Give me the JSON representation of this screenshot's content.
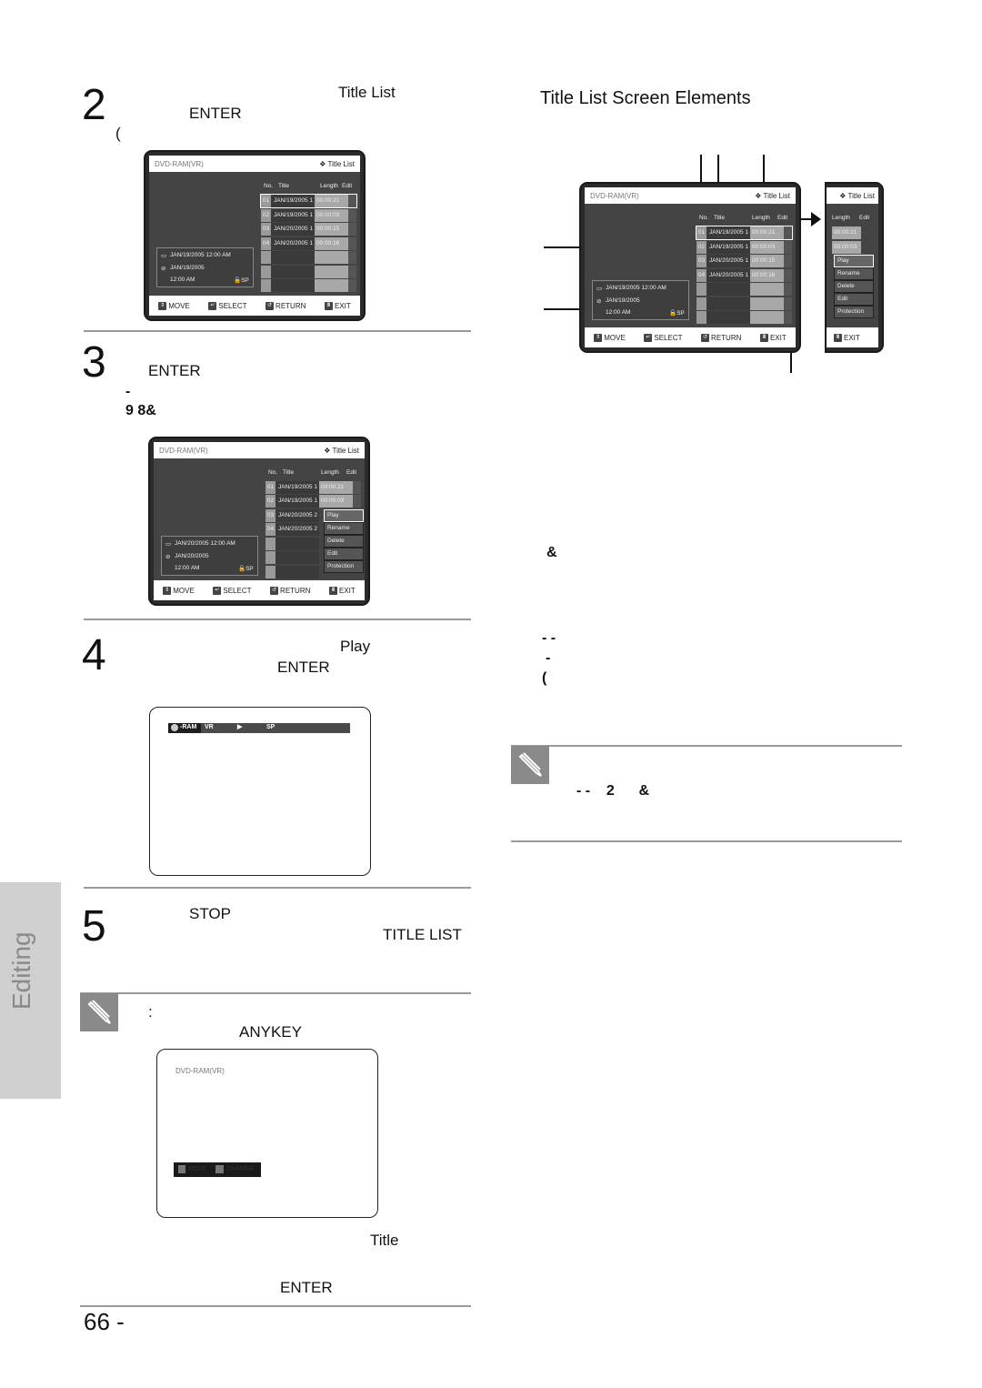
{
  "page": {
    "number": "66 -",
    "side_tab": "Editing"
  },
  "steps": [
    {
      "num": "2",
      "lines": [
        "Title List",
        "ENTER",
        "("
      ]
    },
    {
      "num": "3",
      "lines": [
        "ENTER",
        "-",
        "9   8&"
      ]
    },
    {
      "num": "4",
      "lines": [
        "Play",
        "ENTER"
      ]
    },
    {
      "num": "5",
      "lines": [
        "STOP",
        "TITLE LIST"
      ]
    }
  ],
  "note_left": {
    "lines": [
      ":",
      "ANYKEY"
    ]
  },
  "after_anykey": {
    "lines": [
      "Title",
      "ENTER"
    ]
  },
  "right": {
    "heading": "Title List Screen Elements",
    "marks": [
      "&",
      "- -",
      "-",
      "("
    ],
    "note": {
      "lines": [
        "- -    2      &"
      ]
    }
  },
  "osd_common": {
    "disc": "DVD-RAM(VR)",
    "title": "Title List",
    "col_no": "No.",
    "col_title": "Title",
    "col_length": "Length",
    "col_edit": "Edit",
    "footer": {
      "move": "MOVE",
      "select": "SELECT",
      "return": "RETURN",
      "exit": "EXIT"
    },
    "quality": "SP"
  },
  "osd1": {
    "rows": [
      {
        "no": "01",
        "title": "JAN/19/2005 1",
        "length": "00:00:21"
      },
      {
        "no": "02",
        "title": "JAN/19/2005 1",
        "length": "00:00:03"
      },
      {
        "no": "03",
        "title": "JAN/20/2005 1",
        "length": "00:00:15"
      },
      {
        "no": "04",
        "title": "JAN/20/2005 1",
        "length": "00:00:16"
      }
    ],
    "info": {
      "datetime": "JAN/19/2005 12:00 AM",
      "date": "JAN/19/2005",
      "time": "12:00 AM"
    }
  },
  "osd2": {
    "rows": [
      {
        "no": "01",
        "title": "JAN/19/2005 1",
        "length": "00:00:21"
      },
      {
        "no": "02",
        "title": "JAN/19/2005 1",
        "length": "00:00:03"
      },
      {
        "no": "03",
        "title": "JAN/20/2005 2"
      },
      {
        "no": "04",
        "title": "JAN/20/2005 2"
      }
    ],
    "menu": [
      "Play",
      "Rename",
      "Delete",
      "Edit",
      "Protection"
    ],
    "info": {
      "datetime": "JAN/20/2005 12:00 AM",
      "date": "JAN/20/2005",
      "time": "12:00 AM"
    }
  },
  "play_bar": {
    "disc": "-RAM",
    "mode": "VR",
    "play_symbol": "▶",
    "quality": "SP"
  },
  "anykey_screen": {
    "disc": "DVD-RAM(VR)",
    "move": "MOVE",
    "change": "CHANGE"
  },
  "osd_right": {
    "rows": [
      {
        "no": "01",
        "title": "JAN/19/2005 1",
        "length": "00:00:21"
      },
      {
        "no": "02",
        "title": "JAN/19/2005 1",
        "length": "00:00:03"
      },
      {
        "no": "03",
        "title": "JAN/20/2005 1",
        "length": "00:00:15"
      },
      {
        "no": "04",
        "title": "JAN/20/2005 1",
        "length": "00:00:16"
      }
    ],
    "info": {
      "datetime": "JAN/19/2005 12:00 AM",
      "date": "JAN/19/2005",
      "time": "12:00 AM"
    }
  },
  "osd_partial": {
    "lengths": [
      "00:00:21",
      "00:00:03"
    ],
    "menu": [
      "Play",
      "Rename",
      "Delete",
      "Edit",
      "Protection"
    ]
  }
}
